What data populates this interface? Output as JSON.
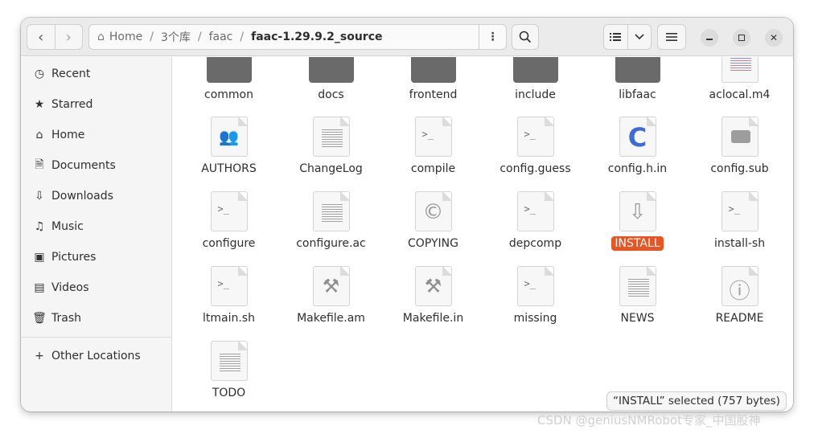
{
  "path": {
    "crumbs": [
      "Home",
      "3个库",
      "faac",
      "faac-1.29.9.2_source"
    ],
    "separator": "/"
  },
  "sidebar": {
    "items": [
      {
        "label": "Recent",
        "icon": "clock-icon",
        "glyph": "◷"
      },
      {
        "label": "Starred",
        "icon": "star-icon",
        "glyph": "★"
      },
      {
        "label": "Home",
        "icon": "home-icon",
        "glyph": "⌂"
      },
      {
        "label": "Documents",
        "icon": "document-icon",
        "glyph": "🗎"
      },
      {
        "label": "Downloads",
        "icon": "download-icon",
        "glyph": "⇩"
      },
      {
        "label": "Music",
        "icon": "music-icon",
        "glyph": "♫"
      },
      {
        "label": "Pictures",
        "icon": "picture-icon",
        "glyph": "▣"
      },
      {
        "label": "Videos",
        "icon": "video-icon",
        "glyph": "▤"
      },
      {
        "label": "Trash",
        "icon": "trash-icon",
        "glyph": "🗑"
      }
    ],
    "other_locations": "Other Locations"
  },
  "files": [
    {
      "name": "common",
      "kind": "folder"
    },
    {
      "name": "docs",
      "kind": "folder"
    },
    {
      "name": "frontend",
      "kind": "folder"
    },
    {
      "name": "include",
      "kind": "folder"
    },
    {
      "name": "libfaac",
      "kind": "folder"
    },
    {
      "name": "aclocal.m4",
      "kind": "m4"
    },
    {
      "name": "AUTHORS",
      "kind": "people"
    },
    {
      "name": "ChangeLog",
      "kind": "text"
    },
    {
      "name": "compile",
      "kind": "script"
    },
    {
      "name": "config.guess",
      "kind": "script"
    },
    {
      "name": "config.h.in",
      "kind": "c"
    },
    {
      "name": "config.sub",
      "kind": "bubble"
    },
    {
      "name": "configure",
      "kind": "script"
    },
    {
      "name": "configure.ac",
      "kind": "text"
    },
    {
      "name": "COPYING",
      "kind": "copyright"
    },
    {
      "name": "depcomp",
      "kind": "script"
    },
    {
      "name": "INSTALL",
      "kind": "install",
      "selected": true
    },
    {
      "name": "install-sh",
      "kind": "script"
    },
    {
      "name": "ltmain.sh",
      "kind": "script"
    },
    {
      "name": "Makefile.am",
      "kind": "make"
    },
    {
      "name": "Makefile.in",
      "kind": "make"
    },
    {
      "name": "missing",
      "kind": "script"
    },
    {
      "name": "NEWS",
      "kind": "text"
    },
    {
      "name": "README",
      "kind": "info"
    },
    {
      "name": "TODO",
      "kind": "text"
    }
  ],
  "status": "“INSTALL” selected  (757 bytes)",
  "watermark": "CSDN @geniusNMRobot专家_中国股神",
  "colors": {
    "selection": "#e95420",
    "c_icon": "#3b6dd8"
  }
}
